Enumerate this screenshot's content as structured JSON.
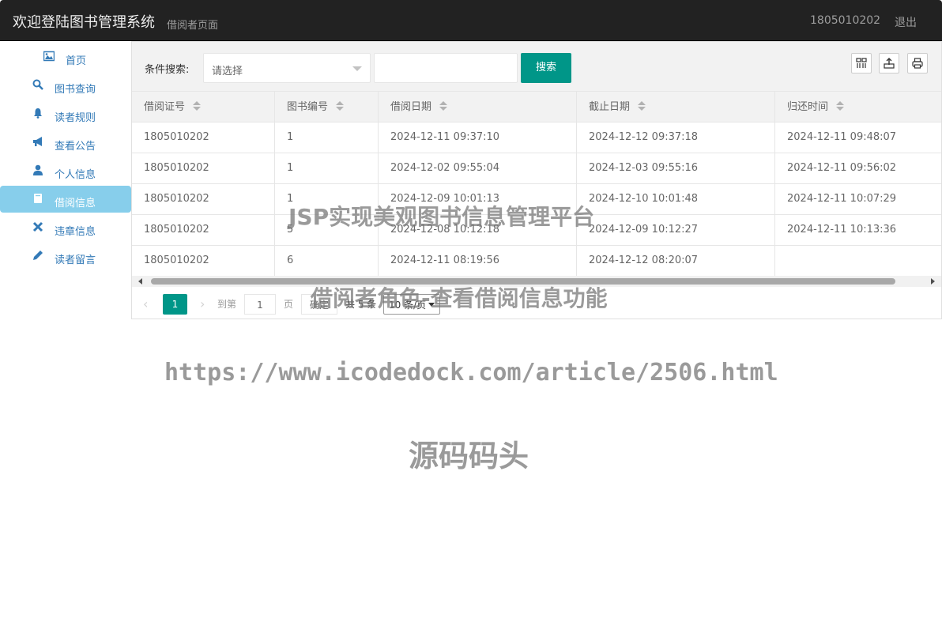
{
  "navbar": {
    "brand": "欢迎登陆图书管理系统",
    "subtitle": "借阅者页面",
    "user": "1805010202",
    "logout": "退出"
  },
  "sidebar": {
    "items": [
      {
        "label": "首页",
        "icon": "image-icon"
      },
      {
        "label": "图书查询",
        "icon": "search-icon"
      },
      {
        "label": "读者规则",
        "icon": "bell-icon"
      },
      {
        "label": "查看公告",
        "icon": "bullhorn-icon"
      },
      {
        "label": "个人信息",
        "icon": "user-icon"
      },
      {
        "label": "借阅信息",
        "icon": "book-icon",
        "active": true
      },
      {
        "label": "违章信息",
        "icon": "close-icon"
      },
      {
        "label": "读者留言",
        "icon": "pencil-icon"
      }
    ]
  },
  "search": {
    "label": "条件搜索:",
    "select_placeholder": "请选择",
    "input_value": "",
    "button": "搜索"
  },
  "toolbar": {
    "icons": [
      "columns-icon",
      "export-icon",
      "print-icon"
    ]
  },
  "table": {
    "headers": [
      "借阅证号",
      "图书编号",
      "借阅日期",
      "截止日期",
      "归还时间"
    ],
    "rows": [
      [
        "1805010202",
        "1",
        "2024-12-11 09:37:10",
        "2024-12-12 09:37:18",
        "2024-12-11 09:48:07"
      ],
      [
        "1805010202",
        "1",
        "2024-12-02 09:55:04",
        "2024-12-03 09:55:16",
        "2024-12-11 09:56:02"
      ],
      [
        "1805010202",
        "1",
        "2024-12-09 10:01:13",
        "2024-12-10 10:01:48",
        "2024-12-11 10:07:29"
      ],
      [
        "1805010202",
        "5",
        "2024-12-08 10:12:18",
        "2024-12-09 10:12:27",
        "2024-12-11 10:13:36"
      ],
      [
        "1805010202",
        "6",
        "2024-12-11 08:19:56",
        "2024-12-12 08:20:07",
        ""
      ]
    ]
  },
  "pager": {
    "current_page": "1",
    "goto_label": "到第",
    "goto_value": "1",
    "page_suffix": "页",
    "confirm": "确定",
    "total": "共 5 条",
    "page_size": "10 条/页"
  },
  "watermarks": {
    "line1": "JSP实现美观图书信息管理平台",
    "line2": "借阅者角色-查看借阅信息功能",
    "line3": "https://www.icodedock.com/article/2506.html",
    "line4": "源码码头"
  },
  "colors": {
    "navbar_bg": "#222222",
    "accent": "#009688",
    "sidebar_active": "#87ceeb",
    "link": "#337ab7"
  }
}
